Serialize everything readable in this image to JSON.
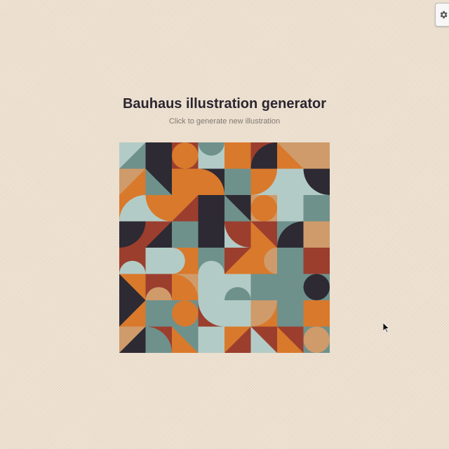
{
  "app": {
    "title": "Bauhaus illustration generator",
    "subtitle": "Click to generate new illustration"
  },
  "toolbar": {
    "settings_icon": "gear-icon"
  },
  "colors": {
    "background": "#efe3d3",
    "charcoal": "#2d2a33",
    "orange": "#d9792c",
    "rust": "#9b3e2e",
    "teal": "#6e918c",
    "mint": "#b3cbc6",
    "tan": "#cf9b6a"
  }
}
